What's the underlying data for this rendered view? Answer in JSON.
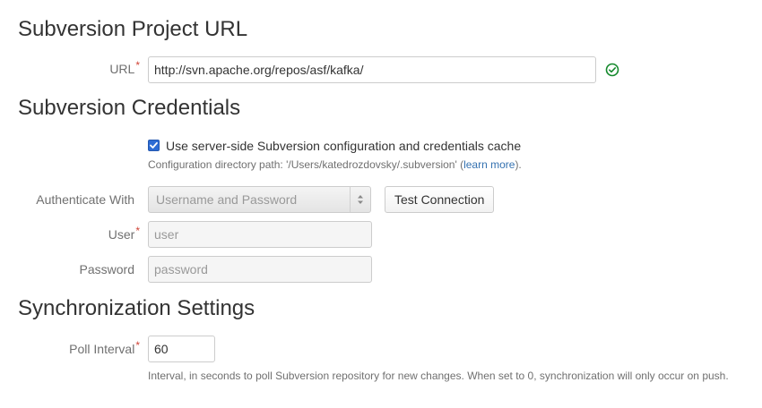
{
  "project_url_section": {
    "title": "Subversion Project URL",
    "url_label": "URL",
    "required_mark": "*",
    "url_value": "http://svn.apache.org/repos/asf/kafka/",
    "valid_icon": "check-circle-icon",
    "valid_color": "#14892c"
  },
  "credentials_section": {
    "title": "Subversion Credentials",
    "server_side_checkbox": {
      "checked": true,
      "label": "Use server-side Subversion configuration and credentials cache"
    },
    "config_path_prefix": "Configuration directory path: '/Users/katedrozdovsky/.subversion' (",
    "learn_more_link": "learn more",
    "config_path_suffix": ").",
    "auth_label": "Authenticate With",
    "auth_selected": "Username and Password",
    "test_connection_label": "Test Connection",
    "user_label": "User",
    "required_mark": "*",
    "user_placeholder": "user",
    "password_label": "Password",
    "password_placeholder": "password"
  },
  "sync_section": {
    "title": "Synchronization Settings",
    "poll_label": "Poll Interval",
    "required_mark": "*",
    "poll_value": "60",
    "poll_help": "Interval, in seconds to poll Subversion repository for new changes. When set to 0, synchronization will only occur on push."
  },
  "colors": {
    "link": "#3572b0",
    "required": "#d04437",
    "checkbox": "#2d6cd4"
  }
}
